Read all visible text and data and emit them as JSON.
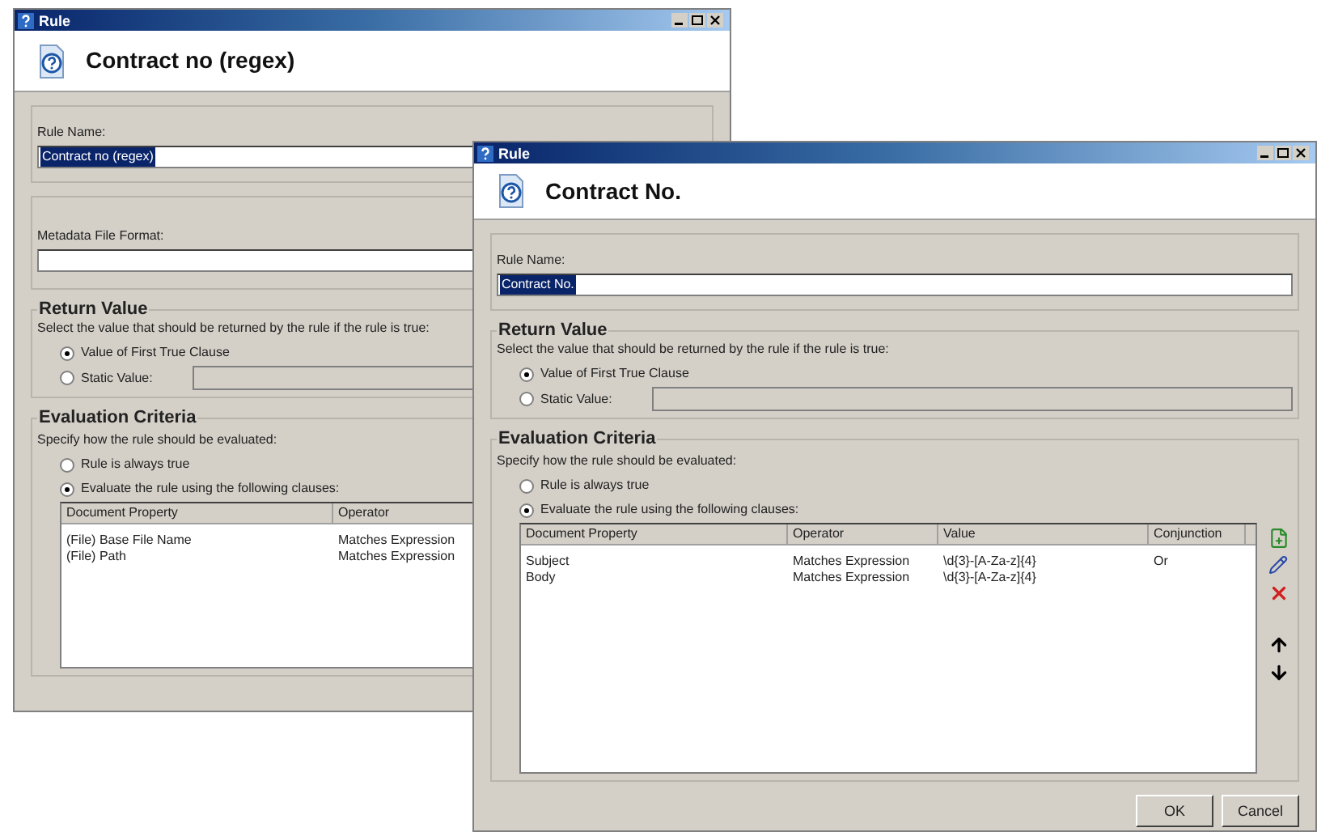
{
  "windows": [
    {
      "title": "Rule",
      "heading": "Contract no (regex)",
      "rule_name": {
        "label": "Rule Name:",
        "value": "Contract no (regex)",
        "text_selected": true
      },
      "metadata_format": {
        "label": "Metadata File Format:"
      },
      "return_value": {
        "legend": "Return Value",
        "description": "Select the value that should be returned by the rule if the rule is true:",
        "options": [
          {
            "label": "Value of First True Clause",
            "selected": true
          },
          {
            "label": "Static Value:",
            "selected": false
          }
        ]
      },
      "evaluation": {
        "legend": "Evaluation Criteria",
        "description": "Specify how the rule should be evaluated:",
        "options": [
          {
            "label": "Rule is always true",
            "selected": false
          },
          {
            "label": "Evaluate the rule using the following clauses:",
            "selected": true
          }
        ],
        "columns": [
          "Document Property",
          "Operator"
        ],
        "rows": [
          [
            "(File) Base File Name",
            "Matches Expression"
          ],
          [
            "(File) Path",
            "Matches Expression"
          ]
        ]
      }
    },
    {
      "title": "Rule",
      "heading": "Contract No.",
      "rule_name": {
        "label": "Rule Name:",
        "value": "Contract No.",
        "text_selected": true
      },
      "return_value": {
        "legend": "Return Value",
        "description": "Select the value that should be returned by the rule if the rule is true:",
        "options": [
          {
            "label": "Value of First True Clause",
            "selected": true
          },
          {
            "label": "Static Value:",
            "selected": false
          }
        ]
      },
      "evaluation": {
        "legend": "Evaluation Criteria",
        "description": "Specify how the rule should be evaluated:",
        "options": [
          {
            "label": "Rule is always true",
            "selected": false
          },
          {
            "label": "Evaluate the rule using the following clauses:",
            "selected": true
          }
        ],
        "columns": [
          "Document Property",
          "Operator",
          "Value",
          "Conjunction"
        ],
        "rows": [
          [
            "Subject",
            "Matches Expression",
            "\\d{3}-[A-Za-z]{4}",
            "Or"
          ],
          [
            "Body",
            "Matches Expression",
            "\\d{3}-[A-Za-z]{4}",
            ""
          ]
        ],
        "tools": true
      },
      "buttons": [
        "OK",
        "Cancel"
      ]
    }
  ]
}
